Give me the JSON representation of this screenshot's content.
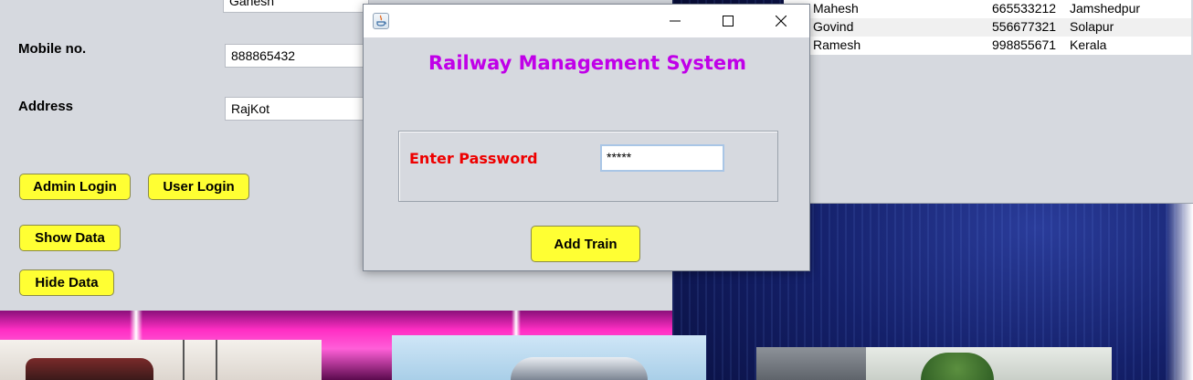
{
  "main_form": {
    "name_value": "Ganesh",
    "mobile_label": "Mobile no.",
    "mobile_value": "888865432",
    "address_label": "Address",
    "address_value": "RajKot",
    "buttons": {
      "admin_login": "Admin Login",
      "user_login": "User Login",
      "show_data": "Show Data",
      "hide_data": "Hide Data"
    }
  },
  "table": {
    "rows": [
      {
        "name": "Mahesh",
        "mobile": "665533212",
        "city": "Jamshedpur"
      },
      {
        "name": "Govind",
        "mobile": "556677321",
        "city": "Solapur"
      },
      {
        "name": "Ramesh",
        "mobile": "998855671",
        "city": "Kerala"
      }
    ]
  },
  "dialog": {
    "title": "Railway Management System",
    "password_label": "Enter Password",
    "password_value": "*****",
    "add_train_button": "Add Train"
  },
  "colors": {
    "button_yellow": "#ffff33",
    "title_purple": "#c000e8",
    "label_red": "#ee0000",
    "window_gray": "#d6d9df"
  },
  "icons": [
    "java-app-icon",
    "minimize-icon",
    "maximize-icon",
    "close-icon"
  ]
}
